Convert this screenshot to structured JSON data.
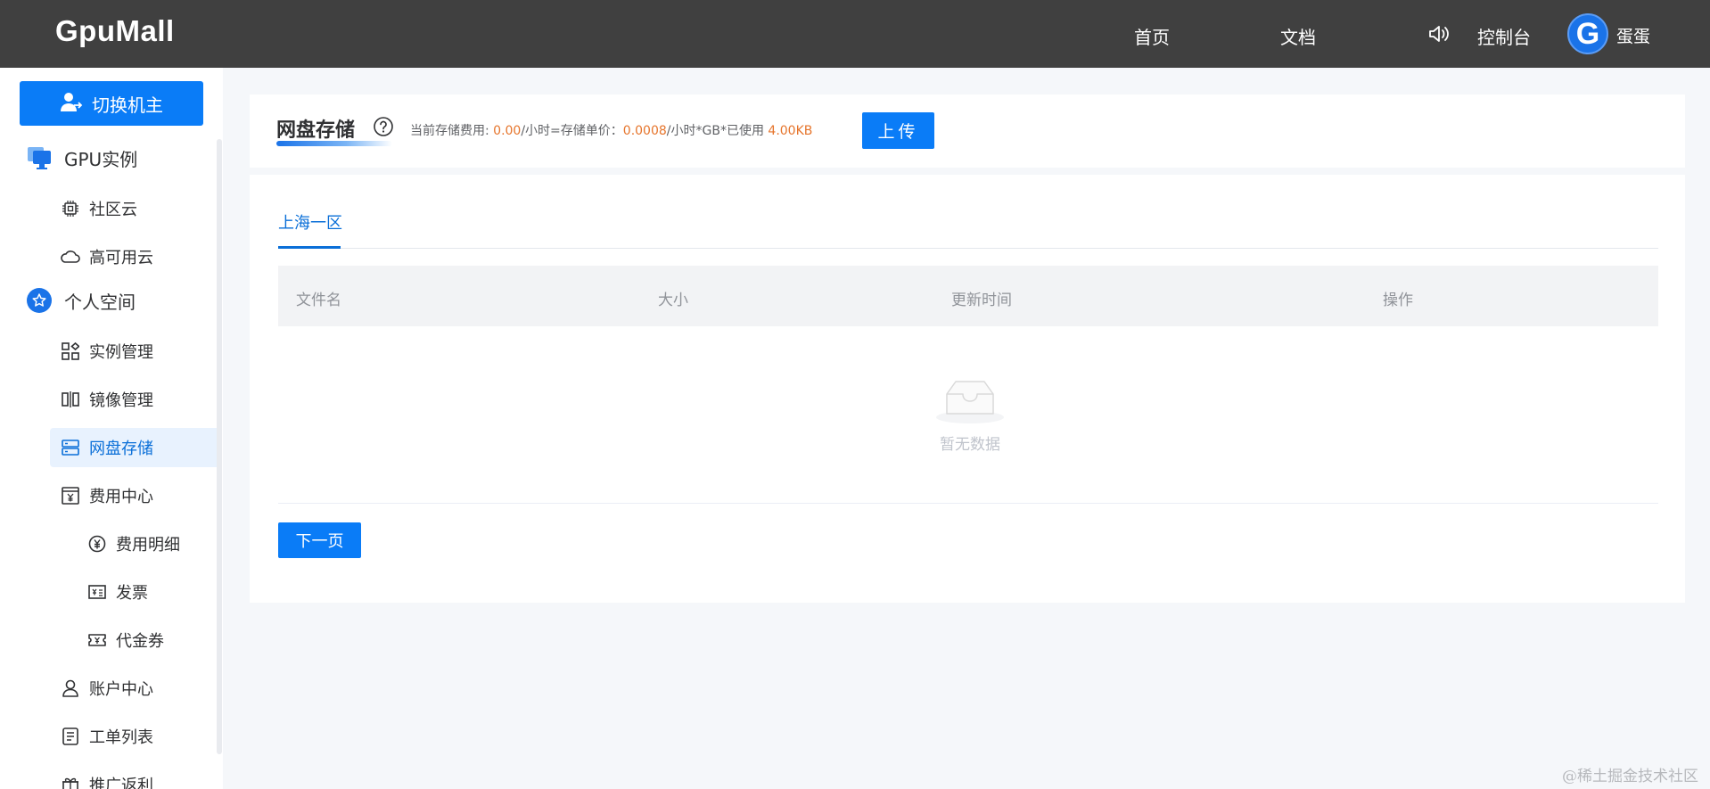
{
  "header": {
    "logo": "GpuMall",
    "nav_home": "首页",
    "nav_docs": "文档",
    "nav_console": "控制台",
    "avatar_letter": "G",
    "username": "蛋蛋"
  },
  "sidebar": {
    "switch_button": "切换机主",
    "groups": [
      {
        "label": "GPU实例",
        "icon": "monitor-icon"
      },
      {
        "label": "个人空间",
        "icon": "star-icon"
      }
    ],
    "items": [
      {
        "label": "社区云",
        "icon": "chip-icon"
      },
      {
        "label": "高可用云",
        "icon": "cloud-icon"
      },
      {
        "label": "实例管理",
        "icon": "grid-icon"
      },
      {
        "label": "镜像管理",
        "icon": "mirror-icon"
      },
      {
        "label": "网盘存储",
        "icon": "storage-icon",
        "active": true
      },
      {
        "label": "费用中心",
        "icon": "billing-icon"
      },
      {
        "label": "费用明细",
        "icon": "yen-icon"
      },
      {
        "label": "发票",
        "icon": "invoice-icon"
      },
      {
        "label": "代金券",
        "icon": "coupon-icon"
      },
      {
        "label": "账户中心",
        "icon": "user-icon"
      },
      {
        "label": "工单列表",
        "icon": "ticket-icon"
      },
      {
        "label": "推广返利",
        "icon": "gift-icon"
      }
    ]
  },
  "storage": {
    "title": "网盘存储",
    "cost_prefix": "当前存储费用: ",
    "cost_value": "0.00",
    "cost_mid": "/小时=存储单价：",
    "unit_price": "0.0008",
    "cost_suffix": "/小时*GB*已使用 ",
    "used": "4.00KB",
    "upload_button": "上传"
  },
  "tabs": [
    {
      "label": "上海一区",
      "active": true
    }
  ],
  "table": {
    "columns": [
      "文件名",
      "大小",
      "更新时间",
      "操作"
    ],
    "rows": [],
    "empty_text": "暂无数据"
  },
  "pagination": {
    "next_label": "下一页"
  },
  "watermark": "@稀土掘金技术社区",
  "colors": {
    "primary": "#0a7cf7",
    "topbar": "#404040",
    "highlight": "#e6752c"
  }
}
